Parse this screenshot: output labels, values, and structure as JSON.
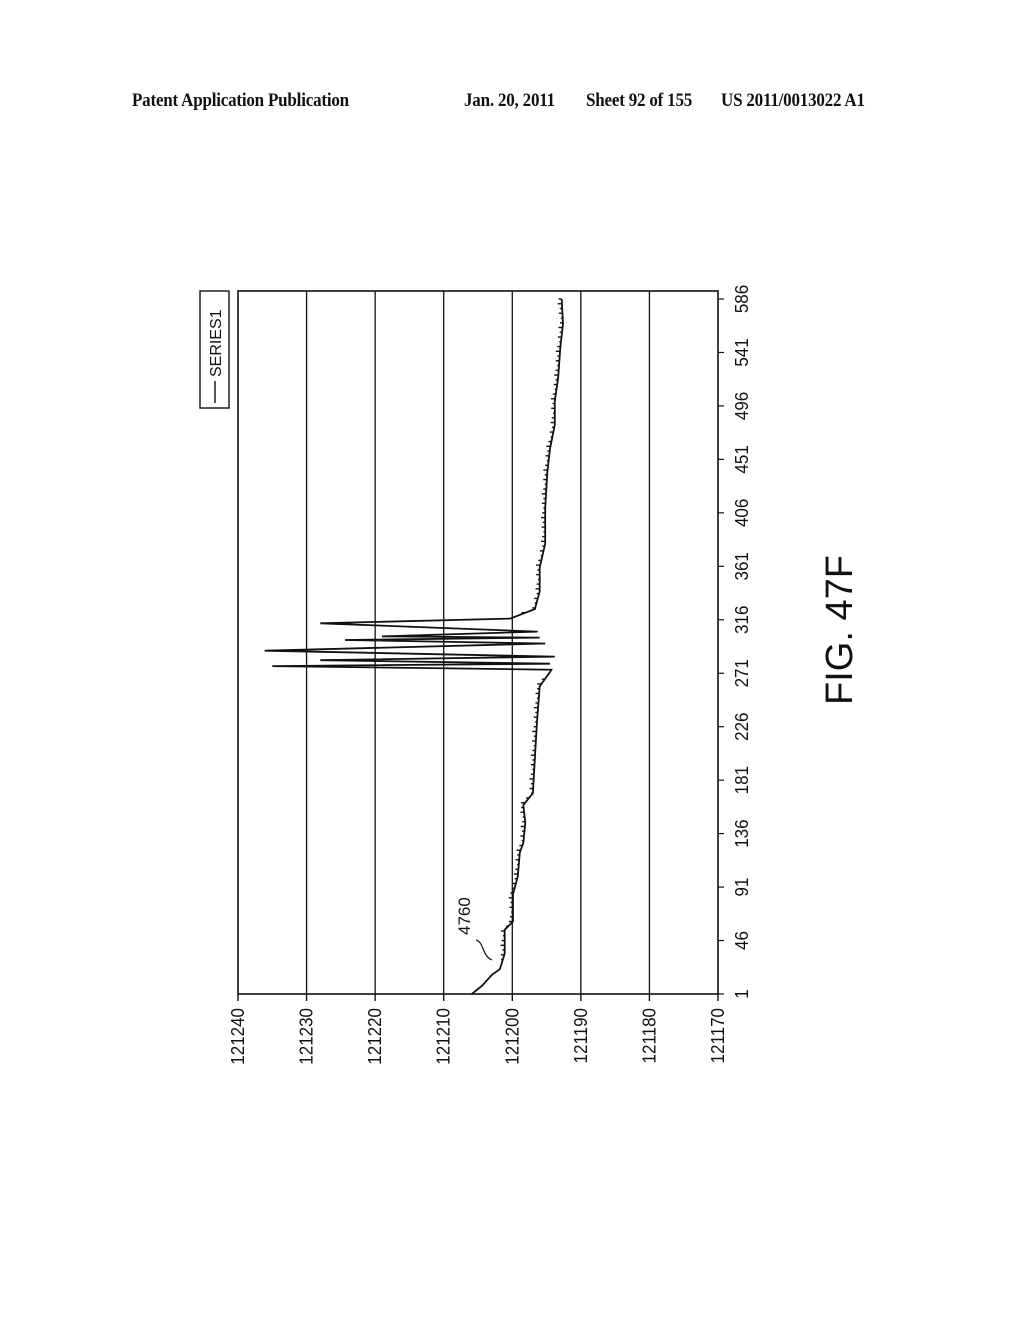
{
  "header": {
    "publication": "Patent Application Publication",
    "date": "Jan. 20, 2011",
    "sheet": "Sheet 92 of 155",
    "number": "US 2011/0013022 A1"
  },
  "figure": {
    "label": "FIG. 47F",
    "reference_numeral": "4760",
    "orientation": "rotated 90° counter-clockwise"
  },
  "chart_data": {
    "type": "line",
    "title": "",
    "xlabel": "",
    "ylabel": "",
    "legend": {
      "entries": [
        "SERIES1"
      ],
      "placement": "top-right (rotated page)"
    },
    "grid": true,
    "x_ticks": [
      1,
      46,
      91,
      136,
      181,
      226,
      271,
      316,
      361,
      406,
      451,
      496,
      541,
      586
    ],
    "y_ticks": [
      121240,
      121230,
      121220,
      121210,
      121200,
      121190,
      121180,
      121170
    ],
    "xlim": [
      1,
      586
    ],
    "ylim": [
      121170,
      121240
    ],
    "series": [
      {
        "name": "SERIES1",
        "x": [
          1,
          8,
          17,
          22,
          35,
          55,
          62,
          85,
          100,
          120,
          128,
          145,
          160,
          170,
          200,
          230,
          260,
          272,
          274,
          277,
          279,
          282,
          285,
          290,
          296,
          299,
          301,
          302,
          306,
          313,
          317,
          325,
          340,
          360,
          380,
          410,
          440,
          460,
          480,
          500,
          520,
          545,
          565,
          586
        ],
        "values": [
          121205.9,
          121204.4,
          121203.0,
          121201.8,
          121201.1,
          121201.1,
          121199.9,
          121199.9,
          121199.2,
          121198.9,
          121198.4,
          121198.1,
          121198.4,
          121197.0,
          121196.7,
          121196.4,
          121196.0,
          121194.5,
          121194.3,
          121235.0,
          121194.5,
          121228.0,
          121193.8,
          121236.1,
          121195.2,
          121224.4,
          121196.0,
          121219.0,
          121196.3,
          121228.0,
          121200.3,
          121196.7,
          121196.0,
          121196.0,
          121195.2,
          121195.2,
          121194.9,
          121194.5,
          121193.8,
          121193.8,
          121193.3,
          121193.0,
          121192.6,
          121192.8
        ]
      }
    ],
    "annotations": [
      {
        "text": "4760",
        "points_to_x": 20
      }
    ]
  }
}
